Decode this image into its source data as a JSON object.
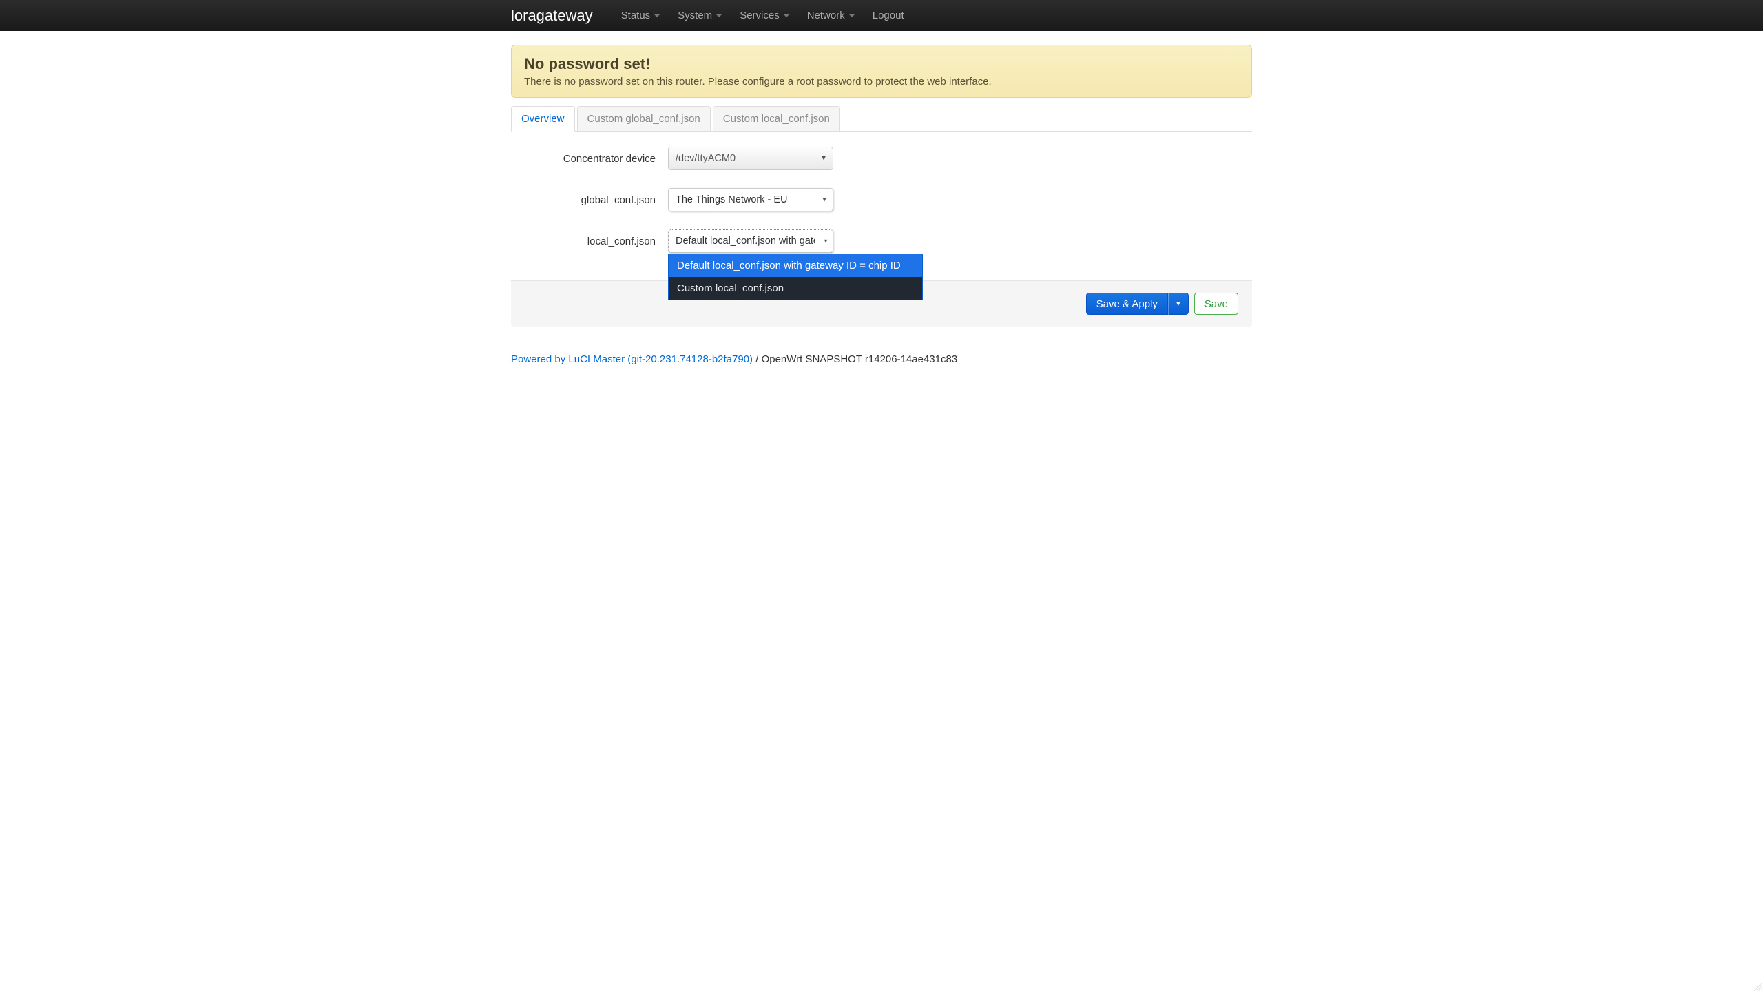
{
  "navbar": {
    "brand": "loragateway",
    "items": [
      {
        "label": "Status",
        "dropdown": true
      },
      {
        "label": "System",
        "dropdown": true
      },
      {
        "label": "Services",
        "dropdown": true
      },
      {
        "label": "Network",
        "dropdown": true
      },
      {
        "label": "Logout",
        "dropdown": false
      }
    ]
  },
  "alert": {
    "title": "No password set!",
    "body": "There is no password set on this router. Please configure a root password to protect the web interface."
  },
  "tabs": [
    {
      "label": "Overview",
      "active": true
    },
    {
      "label": "Custom global_conf.json",
      "active": false
    },
    {
      "label": "Custom local_conf.json",
      "active": false
    }
  ],
  "form": {
    "concentrator": {
      "label": "Concentrator device",
      "value": "/dev/ttyACM0"
    },
    "global_conf": {
      "label": "global_conf.json",
      "value": "The Things Network - EU"
    },
    "local_conf": {
      "label": "local_conf.json",
      "value": "Default local_conf.json with gatew",
      "options": [
        "Default local_conf.json with gateway ID = chip ID",
        "Custom local_conf.json"
      ],
      "selected_index": 0
    }
  },
  "actions": {
    "save_apply": "Save & Apply",
    "save": "Save"
  },
  "footer": {
    "link": "Powered by LuCI Master (git-20.231.74128-b2fa790)",
    "sep": " / ",
    "text": "OpenWrt SNAPSHOT r14206-14ae431c83"
  }
}
